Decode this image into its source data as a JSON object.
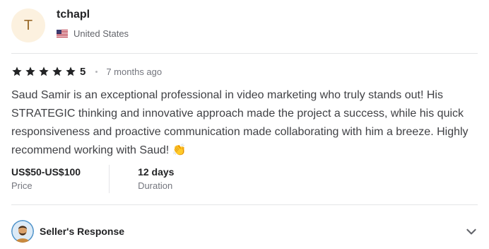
{
  "reviewer": {
    "avatar_initial": "T",
    "username": "tchapl",
    "country": "United States",
    "flag_icon": "us-flag-icon"
  },
  "rating": {
    "stars": 5,
    "value": "5",
    "time_ago": "7 months ago"
  },
  "review": {
    "text": "Saud Samir is an exceptional professional in video marketing who truly stands out! His STRATEGIC thinking and innovative approach made the project a success, while his quick responsiveness and proactive communication made collaborating with him a breeze. Highly recommend working with Saud! 👏"
  },
  "stats": {
    "price_value": "US$50-US$100",
    "price_label": "Price",
    "duration_value": "12 days",
    "duration_label": "Duration"
  },
  "seller_response": {
    "label": "Seller's Response",
    "expand_icon": "chevron-down-icon"
  },
  "colors": {
    "star": "#222325",
    "text": "#404145",
    "muted": "#74767e",
    "divider": "#e4e5e7",
    "avatar_bg": "#fcf1df"
  }
}
